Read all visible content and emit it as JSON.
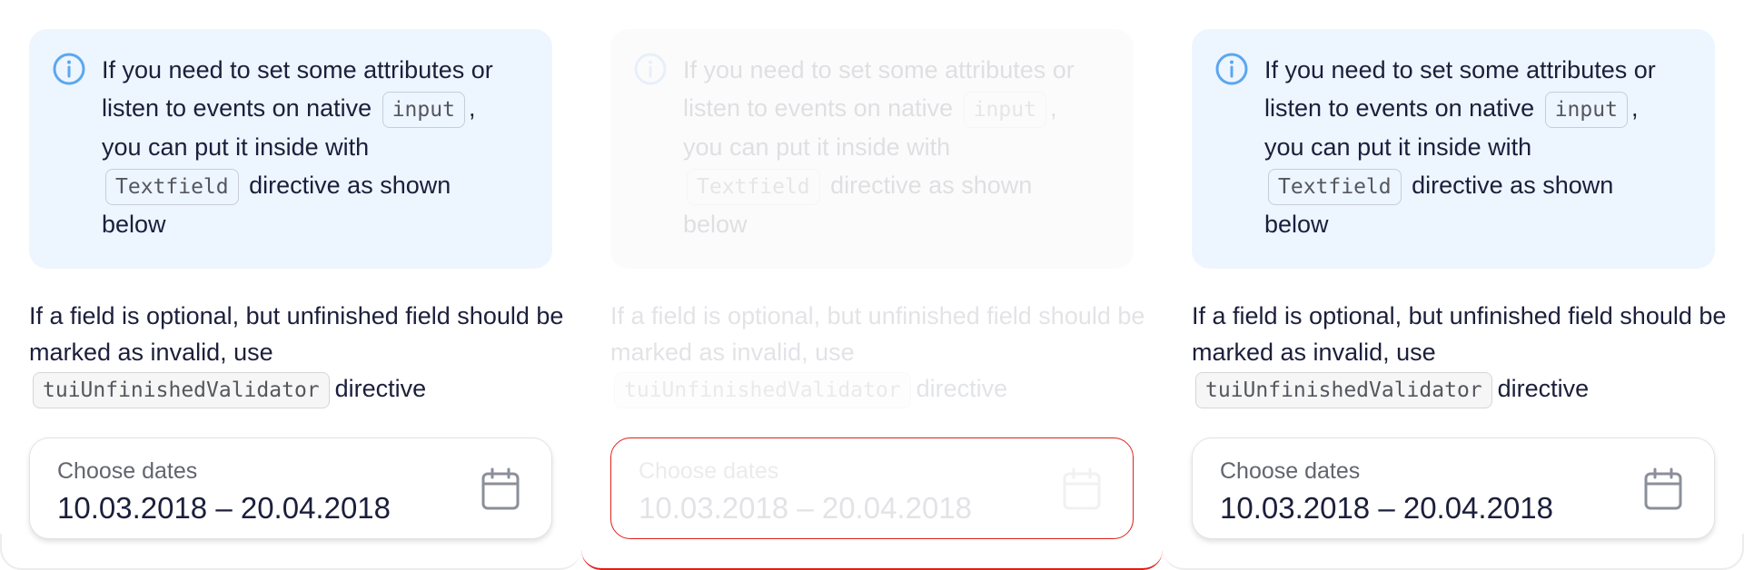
{
  "panels": [
    {
      "state": "normal",
      "notice": {
        "line1": "If you need to set some attributes or",
        "line2_before": "listen to events on native",
        "code1": "input",
        "line2_after": ",",
        "line3": "you can put it inside with",
        "code2": "Textfield",
        "line4_after": "directive as shown",
        "line5": "below"
      },
      "description": {
        "text": "If a field is optional, but unfinished field should be marked as invalid, use",
        "code": "tuiUnfinishedValidator",
        "after": "directive"
      },
      "field": {
        "label": "Choose dates",
        "value": "10.03.2018 – 20.04.2018"
      }
    },
    {
      "state": "invalid",
      "notice": {
        "line1": "If you need to set some attributes or",
        "line2_before": "listen to events on native",
        "code1": "input",
        "line2_after": ",",
        "line3": "you can put it inside with",
        "code2": "Textfield",
        "line4_after": "directive as shown",
        "line5": "below"
      },
      "description": {
        "text": "If a field is optional, but unfinished field should be marked as invalid, use",
        "code": "tuiUnfinishedValidator",
        "after": "directive"
      },
      "field": {
        "label": "Choose dates",
        "value": "10.03.2018 – 20.04.2018"
      }
    },
    {
      "state": "normal",
      "notice": {
        "line1": "If you need to set some attributes or",
        "line2_before": "listen to events on native",
        "code1": "input",
        "line2_after": ",",
        "line3": "you can put it inside with",
        "code2": "Textfield",
        "line4_after": "directive as shown",
        "line5": "below"
      },
      "description": {
        "text": "If a field is optional, but unfinished field should be marked as invalid, use",
        "code": "tuiUnfinishedValidator",
        "after": "directive"
      },
      "field": {
        "label": "Choose dates",
        "value": "10.03.2018 – 20.04.2018"
      }
    }
  ],
  "icons": {
    "info": "info-circle-icon",
    "calendar": "calendar-icon"
  },
  "colors": {
    "notice_bg": "#edf5ff",
    "info_icon": "#5ba7ee",
    "error_border": "#e01f19",
    "text": "#1b1f3b",
    "label": "#62656f"
  }
}
